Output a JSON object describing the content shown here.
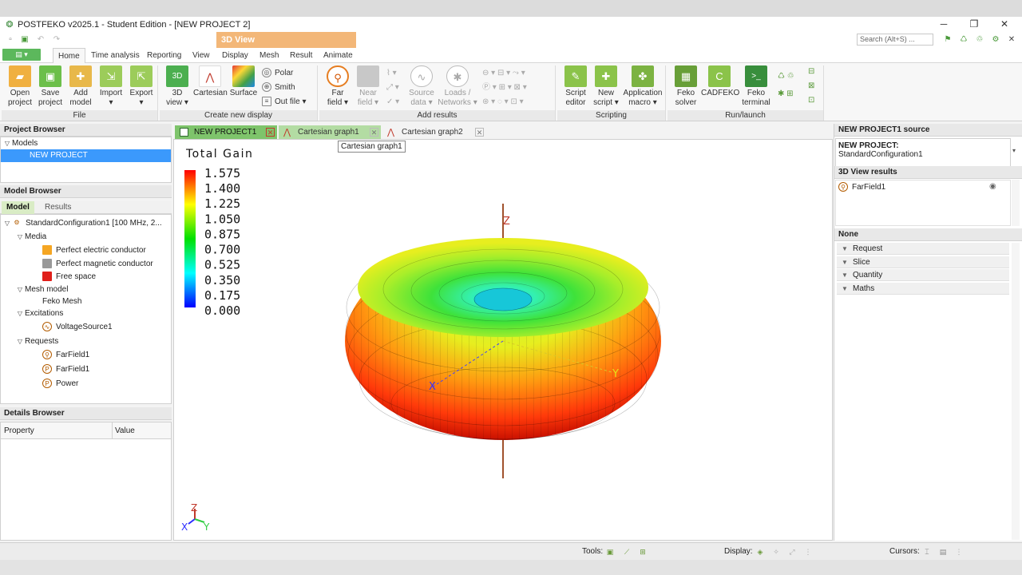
{
  "window": {
    "title": "POSTFEKO v2025.1 - Student Edition - [NEW PROJECT 2]",
    "minimize": "─",
    "maximize": "❐",
    "close": "✕",
    "ribbon_close": "✕"
  },
  "contextual_tab": "3D View",
  "search_placeholder": "Search (Alt+S) ...",
  "menu_tabs": [
    "Home",
    "Time analysis",
    "Reporting",
    "View",
    "Display",
    "Mesh",
    "Result",
    "Animate"
  ],
  "ribbon": {
    "file": {
      "label": "File",
      "open": [
        "Open",
        "project"
      ],
      "save": [
        "Save",
        "project"
      ],
      "add": [
        "Add",
        "model"
      ],
      "import": [
        "Import",
        "▾"
      ],
      "export": [
        "Export",
        "▾"
      ]
    },
    "display": {
      "label": "Create new display",
      "view3d": [
        "3D",
        "view ▾"
      ],
      "view3d_icon": "3D",
      "cartesian": "Cartesian",
      "surface": "Surface",
      "polar": "Polar",
      "smith": "Smith",
      "out_file": "Out file",
      "dropdown": "▾"
    },
    "results": {
      "label": "Add results",
      "far_field": [
        "Far",
        "field ▾"
      ],
      "near_field": [
        "Near",
        "field ▾"
      ],
      "source_data": [
        "Source",
        "data ▾"
      ],
      "loads": [
        "Loads /",
        "Networks ▾"
      ]
    },
    "scripting": {
      "label": "Scripting",
      "script_editor": [
        "Script",
        "editor"
      ],
      "new_script": [
        "New",
        "script ▾"
      ],
      "app_macro": [
        "Application",
        "macro ▾"
      ]
    },
    "run": {
      "label": "Run/launch",
      "feko_solver": [
        "Feko",
        "solver"
      ],
      "cadfeko": "CADFEKO",
      "feko_terminal": [
        "Feko",
        "terminal"
      ],
      "cadfeko_icon": "C",
      "terminal_icon": ">_"
    }
  },
  "project_browser": {
    "title": "Project Browser",
    "models": "Models",
    "project": "NEW PROJECT"
  },
  "model_browser": {
    "title": "Model Browser",
    "tabs": [
      "Model",
      "Results"
    ],
    "config": "StandardConfiguration1 [100 MHz, 2...",
    "media": "Media",
    "media_items": [
      "Perfect electric conductor",
      "Perfect magnetic conductor",
      "Free space"
    ],
    "mesh_model": "Mesh model",
    "feko_mesh": "Feko Mesh",
    "excitations": "Excitations",
    "source": "VoltageSource1",
    "requests": "Requests",
    "request_items": [
      "FarField1",
      "FarField1",
      "Power"
    ]
  },
  "details_browser": {
    "title": "Details Browser",
    "col_property": "Property",
    "col_value": "Value"
  },
  "doc_tabs": [
    "NEW PROJECT1",
    "Cartesian graph1",
    "Cartesian graph2"
  ],
  "tooltip": "Cartesian graph1",
  "legend": {
    "title": "Total Gain",
    "values": [
      "1.575",
      "1.400",
      "1.225",
      "1.050",
      "0.875",
      "0.700",
      "0.525",
      "0.350",
      "0.175",
      "0.000"
    ]
  },
  "axes": {
    "z": "Z",
    "x": "X",
    "y": "Y"
  },
  "right_panel": {
    "source_title": "NEW PROJECT1 source",
    "source_name": "NEW PROJECT:",
    "source_config": "StandardConfiguration1",
    "results_title": "3D View results",
    "result_item": "FarField1",
    "none_title": "None",
    "sections": [
      "Request",
      "Slice",
      "Quantity",
      "Maths"
    ]
  },
  "statusbar": {
    "tools": "Tools:",
    "display": "Display:",
    "cursors": "Cursors:"
  },
  "colors": {
    "accent_green": "#5cb85c",
    "context_tab": "#f3b778",
    "selection": "#3b99fc"
  }
}
